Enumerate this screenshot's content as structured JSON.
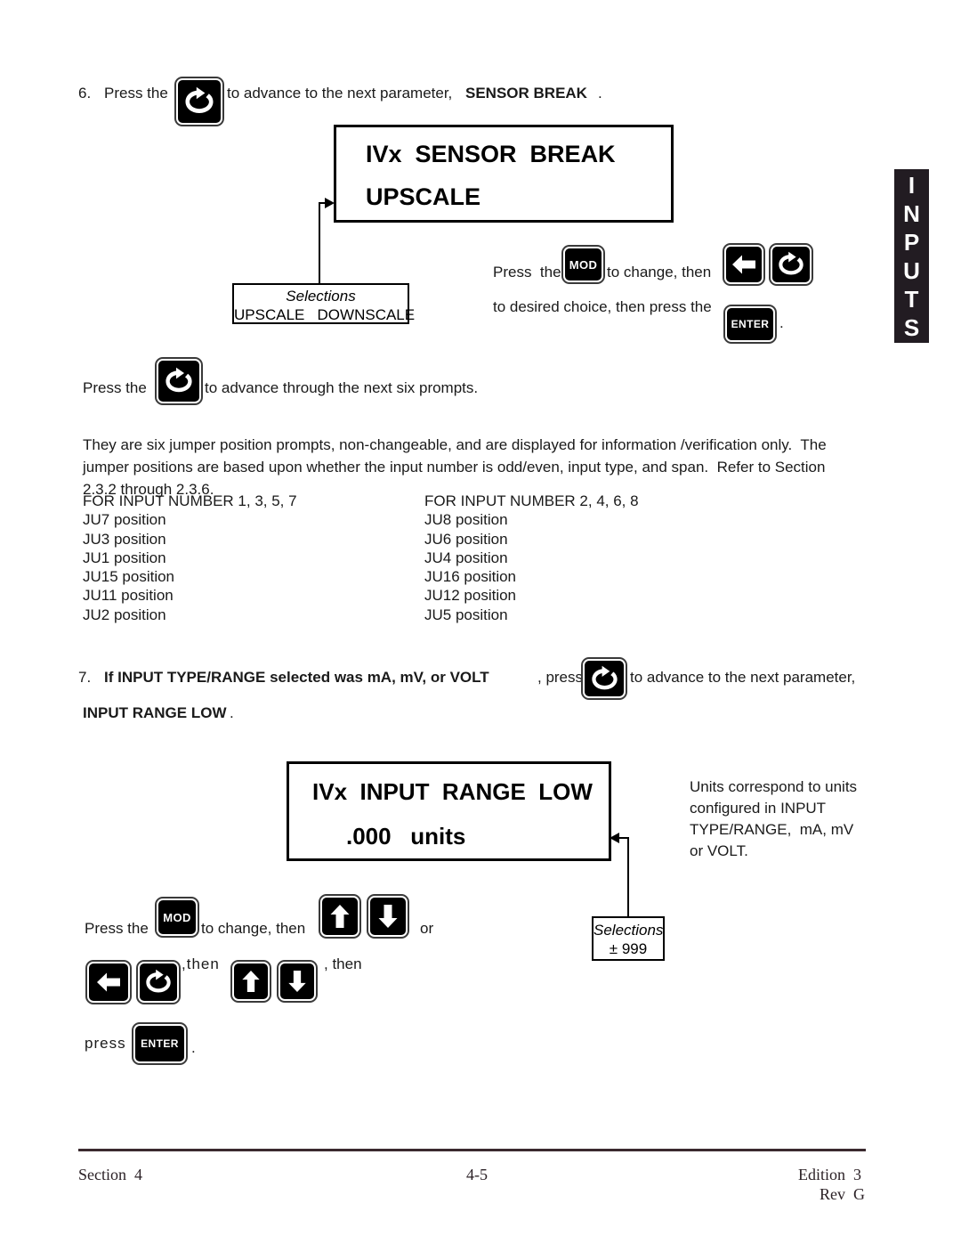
{
  "page": {
    "step6": {
      "number": "6.",
      "text_before": "Press the",
      "text_after": "to advance to the next parameter,",
      "param_name": "SENSOR BREAK",
      "period": "."
    },
    "display1": {
      "line1": "IVx  SENSOR  BREAK",
      "line2": "UPSCALE"
    },
    "selections1": {
      "title": "Selections",
      "options": "UPSCALE   DOWNSCALE"
    },
    "instructions1": {
      "line1_a": "Press  the",
      "line1_b": "to change, then",
      "line2_a": "to desired choice, then press the",
      "line2_b": "."
    },
    "advance_note": {
      "before": "Press the",
      "after": "to advance through the next six prompts."
    },
    "paragraph": "They are six jumper position prompts, non-changeable, and are displayed for information /verification only.  The\njumper positions are based upon whether the input number is odd/even, input type, and span.  Refer to Section\n2.3.2 through 2.3.6.",
    "jumpers": {
      "col1_header": "FOR INPUT NUMBER 1, 3, 5, 7",
      "col1": [
        "JU7 position",
        "JU3 position",
        "JU1 position",
        "JU15 position",
        "JU11 position",
        "JU2 position"
      ],
      "col2_header": "FOR INPUT NUMBER 2, 4, 6, 8",
      "col2": [
        "JU8 position",
        "JU6 position",
        "JU4 position",
        "JU16 position",
        "JU12 position",
        "JU5 position"
      ]
    },
    "step7": {
      "number": "7.",
      "bold_text": "If INPUT TYPE/RANGE selected was mA, mV, or VOLT",
      "text_mid": ", press the",
      "text_after": "to advance to the next parameter,",
      "param_name": "INPUT RANGE LOW",
      "period": "."
    },
    "display2": {
      "line1": "IVx  INPUT  RANGE  LOW",
      "line2": ".000   units"
    },
    "units_note": "Units correspond to units\nconfigured in INPUT\nTYPE/RANGE,  mA, mV\nor VOLT.",
    "selections2": {
      "title": "Selections",
      "options": "± 999"
    },
    "instructions2": {
      "line1_a": "Press the",
      "line1_b": "to change, then",
      "line1_c": "or",
      "line2_a": ",then",
      "line2_b": ", then",
      "line3_a": "press",
      "line3_b": "."
    },
    "side_tab": {
      "letters": [
        "I",
        "N",
        "P",
        "U",
        "T",
        "S"
      ]
    },
    "footer": {
      "left": "Section  4",
      "center": "4-5",
      "right_line1": "Edition  3",
      "right_line2": "Rev  G"
    },
    "keys": {
      "mod_label": "MOD",
      "enter_label": "ENTER"
    }
  }
}
